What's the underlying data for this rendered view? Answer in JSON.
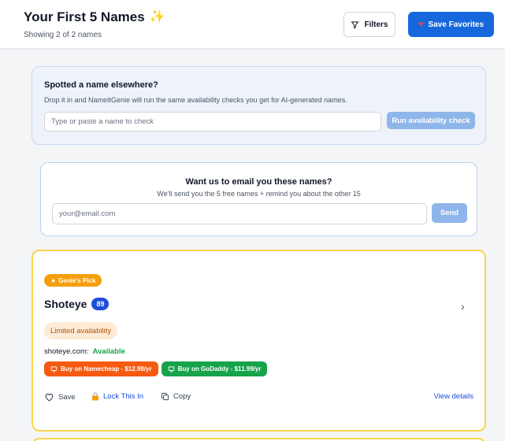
{
  "header": {
    "title": "Your First 5 Names",
    "subtitle": "Showing 2 of 2 names",
    "filters_label": "Filters",
    "save_favorites_label": "Save Favorites"
  },
  "spotted": {
    "title": "Spotted a name elsewhere?",
    "description": "Drop it in and NameItGenie will run the same availability checks you get for AI-generated names.",
    "input_placeholder": "Type or paste a name to check",
    "button_label": "Run availability check"
  },
  "email_capture": {
    "title": "Want us to email you these names?",
    "description": "We'll send you the 5 free names + remind you about the other 15",
    "input_placeholder": "your@email.com",
    "button_label": "Send"
  },
  "name_card": {
    "badge": "Genie's Pick",
    "name": "Shoteye",
    "score": "89",
    "availability_badge": "Limited availability",
    "domain": "shoteye.com:",
    "domain_status": "Available",
    "buy_namecheap": "Buy on Namecheap - $12.98/yr",
    "buy_godaddy": "Buy on GoDaddy - $11.99/yr",
    "actions": {
      "save": "Save",
      "lock": "Lock This In",
      "copy": "Copy",
      "view_details": "View details"
    }
  },
  "colors": {
    "primary": "#1668dc",
    "card_border": "#fbd34d",
    "available": "#16a34a",
    "namecheap": "#f55a10",
    "godaddy": "#16a34a"
  }
}
